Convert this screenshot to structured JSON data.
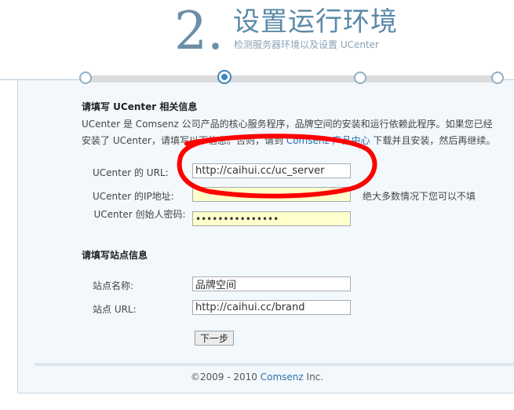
{
  "header": {
    "step_number": "2.",
    "title": "设置运行环境",
    "subtitle": "检测服务器环境以及设置 UCenter"
  },
  "ucenter_section": {
    "title": "请填写 UCenter 相关信息",
    "desc_line1": "UCenter 是 Comsenz 公司产品的核心服务程序，品牌空间的安装和运行依赖此程序。如果您已经",
    "desc_line2_before": "安装了 UCenter，请填写以下信息。否则，请到 ",
    "desc_link": "Comsenz 产品中心",
    "desc_line2_after": " 下载并且安装，然后再继续。",
    "url_label": "UCenter 的 URL:",
    "url_value": "http://caihui.cc/uc_server",
    "ip_label": "UCenter 的IP地址:",
    "ip_value": "",
    "ip_hint": "绝大多数情况下您可以不填",
    "pw_label": "UCenter 创始人密码:",
    "pw_value": "•••••••••••••••"
  },
  "site_section": {
    "title": "请填写站点信息",
    "name_label": "站点名称:",
    "name_value": "品牌空间",
    "url_label": "站点 URL:",
    "url_value": "http://caihui.cc/brand"
  },
  "next_button": "下一步",
  "footer": {
    "prefix": "©2009 - 2010 ",
    "link": "Comsenz",
    "suffix": " Inc."
  },
  "colors": {
    "accent": "#3d86b9",
    "annotation": "#ff0000",
    "highlight_input": "#ffffcc"
  },
  "progress": {
    "total_steps": 4,
    "current_step": 2
  }
}
